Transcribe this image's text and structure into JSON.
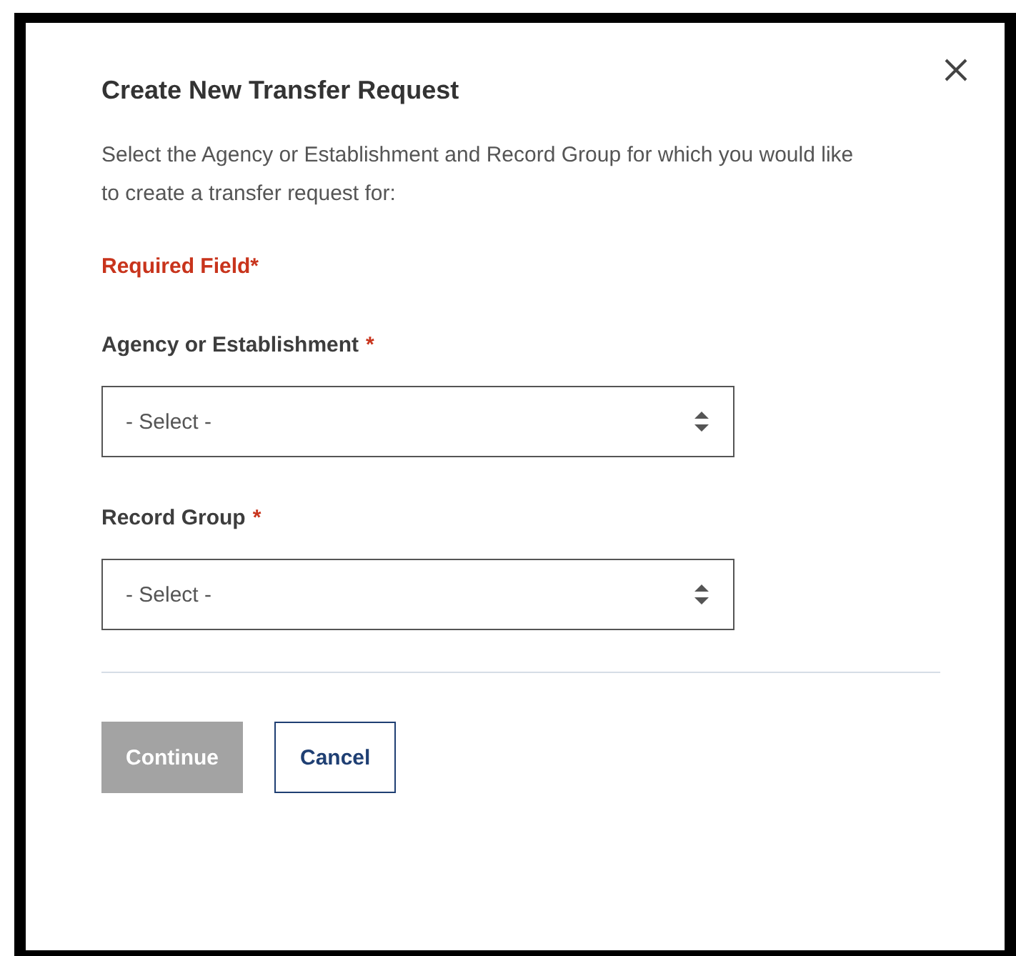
{
  "dialog": {
    "title": "Create New Transfer Request",
    "description": "Select the Agency or Establishment and Record Group for which you would like to create a transfer request for:",
    "required_note": "Required Field*",
    "fields": [
      {
        "label": "Agency or Establishment",
        "required_mark": "*",
        "value": "- Select -"
      },
      {
        "label": "Record Group",
        "required_mark": "*",
        "value": "- Select -"
      }
    ],
    "buttons": [
      {
        "label": "Continue",
        "kind": "primary",
        "disabled": true
      },
      {
        "label": "Cancel",
        "kind": "secondary",
        "disabled": false
      }
    ]
  }
}
